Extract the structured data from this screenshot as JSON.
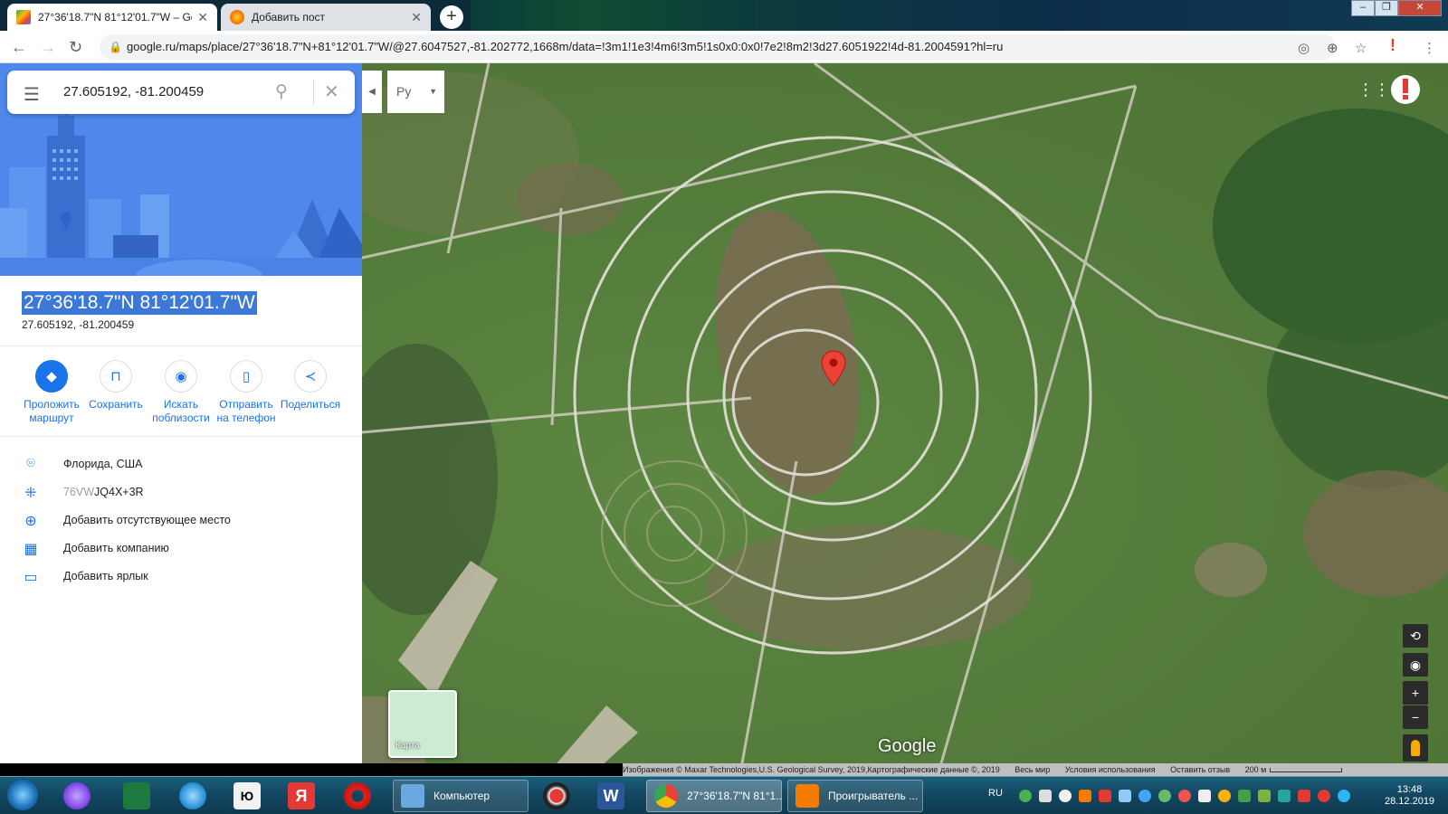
{
  "tabs": [
    {
      "title": "27°36'18.7\"N 81°12'01.7\"W – Goo",
      "active": true
    },
    {
      "title": "Добавить пост",
      "active": false
    }
  ],
  "address_bar": {
    "url": "google.ru/maps/place/27°36'18.7\"N+81°12'01.7\"W/@27.6047527,-81.202772,1668m/data=!3m1!1e3!4m6!3m5!1s0x0:0x0!7e2!8m2!3d27.6051922!4d-81.2004591?hl=ru"
  },
  "search": {
    "query": "27.605192, -81.200459"
  },
  "place": {
    "title": "27°36'18.7\"N 81°12'01.7\"W",
    "subtitle": "27.605192, -81.200459"
  },
  "actions": [
    {
      "label": "Проложить маршрут",
      "icon": "directions-icon"
    },
    {
      "label": "Сохранить",
      "icon": "bookmark-icon"
    },
    {
      "label": "Искать поблизости",
      "icon": "nearby-icon"
    },
    {
      "label": "Отправить на телефон",
      "icon": "send-to-phone-icon"
    },
    {
      "label": "Поделиться",
      "icon": "share-icon"
    }
  ],
  "info": {
    "region": "Флорида, США",
    "plus_code_prefix": "76VW",
    "plus_code_rest": "JQ4X+3R",
    "add_missing_place": "Добавить отсутствующее место",
    "add_business": "Добавить компанию",
    "add_label": "Добавить ярлык"
  },
  "map": {
    "language_selector": "Ру",
    "minimap_label": "Карта",
    "logo": "Google",
    "attribution": "Изображения © Maxar Technologies,U.S. Geological Survey, 2019,Картографические данные ©, 2019",
    "world": "Весь мир",
    "terms": "Условия использования",
    "feedback": "Оставить отзыв",
    "scale": "200 м"
  },
  "taskbar": {
    "windows": [
      {
        "label": "Компьютер"
      },
      {
        "label": "27°36'18.7\"N 81°1..."
      },
      {
        "label": "Проигрыватель ..."
      }
    ],
    "lang": "RU",
    "time": "13:48",
    "date": "28.12.2019"
  }
}
